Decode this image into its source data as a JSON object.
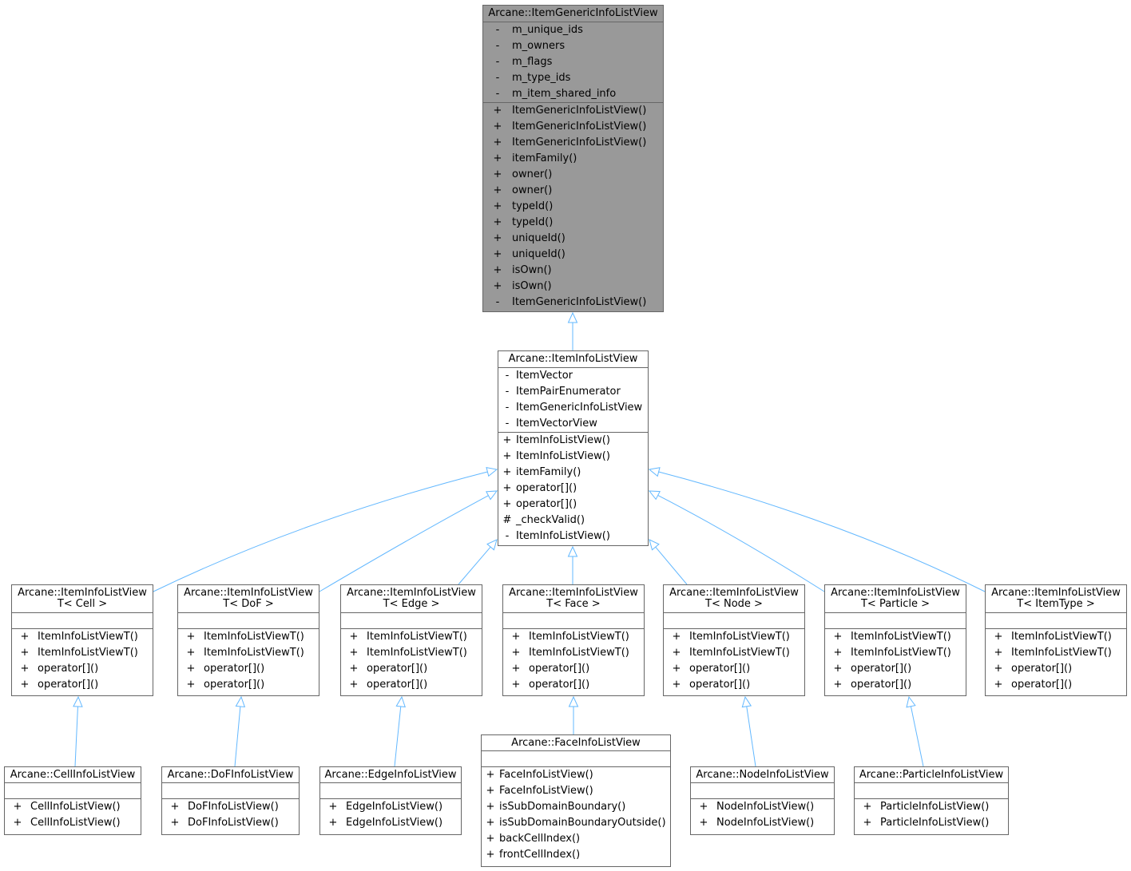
{
  "diagram": {
    "type": "class-inheritance-graph",
    "edge_color": "#63b8ff",
    "border_color": "#666666",
    "highlight_fill": "#999999",
    "classes": {
      "generic": {
        "title": "Arcane::ItemGenericInfoListView",
        "attributes": [
          {
            "vis": "-",
            "name": "m_unique_ids"
          },
          {
            "vis": "-",
            "name": "m_owners"
          },
          {
            "vis": "-",
            "name": "m_flags"
          },
          {
            "vis": "-",
            "name": "m_type_ids"
          },
          {
            "vis": "-",
            "name": "m_item_shared_info"
          }
        ],
        "methods": [
          {
            "vis": "+",
            "name": "ItemGenericInfoListView()"
          },
          {
            "vis": "+",
            "name": "ItemGenericInfoListView()"
          },
          {
            "vis": "+",
            "name": "ItemGenericInfoListView()"
          },
          {
            "vis": "+",
            "name": "itemFamily()"
          },
          {
            "vis": "+",
            "name": "owner()"
          },
          {
            "vis": "+",
            "name": "owner()"
          },
          {
            "vis": "+",
            "name": "typeId()"
          },
          {
            "vis": "+",
            "name": "typeId()"
          },
          {
            "vis": "+",
            "name": "uniqueId()"
          },
          {
            "vis": "+",
            "name": "uniqueId()"
          },
          {
            "vis": "+",
            "name": "isOwn()"
          },
          {
            "vis": "+",
            "name": "isOwn()"
          },
          {
            "vis": "-",
            "name": "ItemGenericInfoListView()"
          }
        ]
      },
      "base": {
        "title": "Arcane::ItemInfoListView",
        "attributes": [
          {
            "vis": "-",
            "name": "ItemVector"
          },
          {
            "vis": "-",
            "name": "ItemPairEnumerator"
          },
          {
            "vis": "-",
            "name": "ItemGenericInfoListView"
          },
          {
            "vis": "-",
            "name": "ItemVectorView"
          }
        ],
        "methods": [
          {
            "vis": "+",
            "name": "ItemInfoListView()"
          },
          {
            "vis": "+",
            "name": "ItemInfoListView()"
          },
          {
            "vis": "+",
            "name": "itemFamily()"
          },
          {
            "vis": "+",
            "name": "operator[]()"
          },
          {
            "vis": "+",
            "name": "operator[]()"
          },
          {
            "vis": "#",
            "name": "_checkValid()"
          },
          {
            "vis": "-",
            "name": "ItemInfoListView()"
          }
        ]
      },
      "t_cell": {
        "title": "Arcane::ItemInfoListView\nT< Cell >",
        "attributes": [],
        "methods": [
          {
            "vis": "+",
            "name": "ItemInfoListViewT()"
          },
          {
            "vis": "+",
            "name": "ItemInfoListViewT()"
          },
          {
            "vis": "+",
            "name": "operator[]()"
          },
          {
            "vis": "+",
            "name": "operator[]()"
          }
        ]
      },
      "t_dof": {
        "title": "Arcane::ItemInfoListView\nT< DoF >",
        "attributes": [],
        "methods": [
          {
            "vis": "+",
            "name": "ItemInfoListViewT()"
          },
          {
            "vis": "+",
            "name": "ItemInfoListViewT()"
          },
          {
            "vis": "+",
            "name": "operator[]()"
          },
          {
            "vis": "+",
            "name": "operator[]()"
          }
        ]
      },
      "t_edge": {
        "title": "Arcane::ItemInfoListView\nT< Edge >",
        "attributes": [],
        "methods": [
          {
            "vis": "+",
            "name": "ItemInfoListViewT()"
          },
          {
            "vis": "+",
            "name": "ItemInfoListViewT()"
          },
          {
            "vis": "+",
            "name": "operator[]()"
          },
          {
            "vis": "+",
            "name": "operator[]()"
          }
        ]
      },
      "t_face": {
        "title": "Arcane::ItemInfoListView\nT< Face >",
        "attributes": [],
        "methods": [
          {
            "vis": "+",
            "name": "ItemInfoListViewT()"
          },
          {
            "vis": "+",
            "name": "ItemInfoListViewT()"
          },
          {
            "vis": "+",
            "name": "operator[]()"
          },
          {
            "vis": "+",
            "name": "operator[]()"
          }
        ]
      },
      "t_node": {
        "title": "Arcane::ItemInfoListView\nT< Node >",
        "attributes": [],
        "methods": [
          {
            "vis": "+",
            "name": "ItemInfoListViewT()"
          },
          {
            "vis": "+",
            "name": "ItemInfoListViewT()"
          },
          {
            "vis": "+",
            "name": "operator[]()"
          },
          {
            "vis": "+",
            "name": "operator[]()"
          }
        ]
      },
      "t_particle": {
        "title": "Arcane::ItemInfoListView\nT< Particle >",
        "attributes": [],
        "methods": [
          {
            "vis": "+",
            "name": "ItemInfoListViewT()"
          },
          {
            "vis": "+",
            "name": "ItemInfoListViewT()"
          },
          {
            "vis": "+",
            "name": "operator[]()"
          },
          {
            "vis": "+",
            "name": "operator[]()"
          }
        ]
      },
      "t_itemtype": {
        "title": "Arcane::ItemInfoListView\nT< ItemType >",
        "attributes": [],
        "methods": [
          {
            "vis": "+",
            "name": "ItemInfoListViewT()"
          },
          {
            "vis": "+",
            "name": "ItemInfoListViewT()"
          },
          {
            "vis": "+",
            "name": "operator[]()"
          },
          {
            "vis": "+",
            "name": "operator[]()"
          }
        ]
      },
      "cell": {
        "title": "Arcane::CellInfoListView",
        "attributes": [],
        "methods": [
          {
            "vis": "+",
            "name": "CellInfoListView()"
          },
          {
            "vis": "+",
            "name": "CellInfoListView()"
          }
        ]
      },
      "dof": {
        "title": "Arcane::DoFInfoListView",
        "attributes": [],
        "methods": [
          {
            "vis": "+",
            "name": "DoFInfoListView()"
          },
          {
            "vis": "+",
            "name": "DoFInfoListView()"
          }
        ]
      },
      "edge": {
        "title": "Arcane::EdgeInfoListView",
        "attributes": [],
        "methods": [
          {
            "vis": "+",
            "name": "EdgeInfoListView()"
          },
          {
            "vis": "+",
            "name": "EdgeInfoListView()"
          }
        ]
      },
      "face": {
        "title": "Arcane::FaceInfoListView",
        "attributes": [],
        "methods": [
          {
            "vis": "+",
            "name": "FaceInfoListView()"
          },
          {
            "vis": "+",
            "name": "FaceInfoListView()"
          },
          {
            "vis": "+",
            "name": "isSubDomainBoundary()"
          },
          {
            "vis": "+",
            "name": "isSubDomainBoundaryOutside()"
          },
          {
            "vis": "+",
            "name": "backCellIndex()"
          },
          {
            "vis": "+",
            "name": "frontCellIndex()"
          }
        ]
      },
      "node": {
        "title": "Arcane::NodeInfoListView",
        "attributes": [],
        "methods": [
          {
            "vis": "+",
            "name": "NodeInfoListView()"
          },
          {
            "vis": "+",
            "name": "NodeInfoListView()"
          }
        ]
      },
      "particle": {
        "title": "Arcane::ParticleInfoListView",
        "attributes": [],
        "methods": [
          {
            "vis": "+",
            "name": "ParticleInfoListView()"
          },
          {
            "vis": "+",
            "name": "ParticleInfoListView()"
          }
        ]
      }
    },
    "inheritance": [
      {
        "child": "base",
        "parent": "generic"
      },
      {
        "child": "t_cell",
        "parent": "base"
      },
      {
        "child": "t_dof",
        "parent": "base"
      },
      {
        "child": "t_edge",
        "parent": "base"
      },
      {
        "child": "t_face",
        "parent": "base"
      },
      {
        "child": "t_node",
        "parent": "base"
      },
      {
        "child": "t_particle",
        "parent": "base"
      },
      {
        "child": "t_itemtype",
        "parent": "base"
      },
      {
        "child": "cell",
        "parent": "t_cell"
      },
      {
        "child": "dof",
        "parent": "t_dof"
      },
      {
        "child": "edge",
        "parent": "t_edge"
      },
      {
        "child": "face",
        "parent": "t_face"
      },
      {
        "child": "node",
        "parent": "t_node"
      },
      {
        "child": "particle",
        "parent": "t_particle"
      }
    ]
  }
}
